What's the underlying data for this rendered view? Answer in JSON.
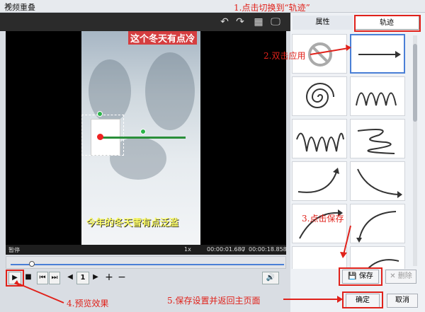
{
  "window": {
    "title": "视频重叠",
    "close_label": "×"
  },
  "toolbar": {
    "undo": "↶",
    "redo": "↷",
    "grid": "▦",
    "screen": "🖵"
  },
  "video": {
    "caption_top": "这个冬天有点冷",
    "caption_bottom": "今年的冬天雪有点泛滥"
  },
  "status": {
    "label": "暂停",
    "zoom": "1x",
    "time_current": "00:00:01.680",
    "time_separator": "/",
    "time_total": "00:00:18.858"
  },
  "controls": {
    "play": "▶",
    "stop": "■",
    "prev": "⏮",
    "next": "⏭",
    "frame_value": "1",
    "prev_frame": "◀",
    "next_frame": "▶",
    "add": "+",
    "remove": "−",
    "volume": "🔊"
  },
  "tabs": [
    {
      "label": "属性"
    },
    {
      "label": "轨迹"
    }
  ],
  "buttons": {
    "save": "保存",
    "delete": "删除",
    "ok": "确定",
    "cancel": "取消"
  },
  "annotations": {
    "a1": "1.点击切换到“轨迹”",
    "a2": "2.双击应用",
    "a3": "3.点击保存",
    "a4": "4.预览效果",
    "a5": "5.保存设置并返回主页面"
  },
  "colors": {
    "annotation": "#e0221b",
    "selection": "#4a7fd6",
    "track": "#2a8f3a"
  }
}
